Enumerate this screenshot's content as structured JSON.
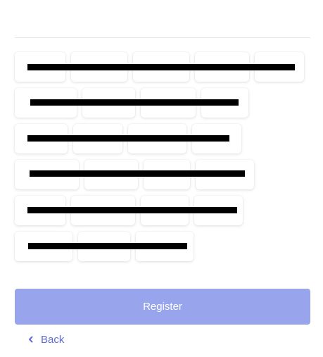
{
  "chips": [
    "",
    "",
    "",
    "",
    "",
    "",
    "",
    "",
    "",
    "",
    "",
    "",
    "",
    "",
    "",
    "",
    "",
    "",
    "",
    "",
    "",
    "",
    "",
    "",
    ""
  ],
  "register_label": "Register",
  "back_label": "Back",
  "colors": {
    "accent": "#5f6bd8",
    "button_disabled": "#98a4ec",
    "redaction": "#000000"
  },
  "icons": {
    "back": "chevron-left-icon"
  }
}
